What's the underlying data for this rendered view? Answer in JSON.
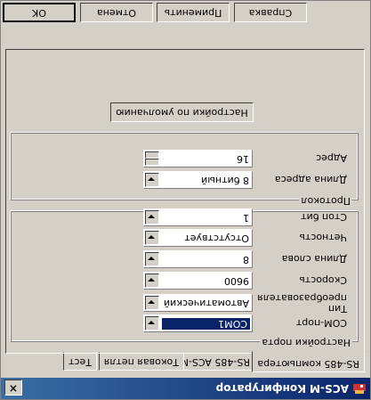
{
  "window": {
    "title": "ACS-M Конфигуратор",
    "close_glyph": "×"
  },
  "tabs": [
    {
      "label": "RS-485 компьютера"
    },
    {
      "label": "RS-485 ACS-M"
    },
    {
      "label": "Токовая петля"
    },
    {
      "label": "Тест"
    }
  ],
  "port_group": {
    "title": "Настройки порта",
    "com_label": "COM-порт",
    "com_value": "COM1",
    "conv_label_1": "Тип",
    "conv_label_2": "преобразователя",
    "conv_value": "Автоматический",
    "speed_label": "Скорость",
    "speed_value": "9600",
    "wordlen_label": "Длина слова",
    "wordlen_value": "8",
    "parity_label": "Четность",
    "parity_value": "Отсутствует",
    "stop_label": "Стоп бит",
    "stop_value": "1"
  },
  "protocol_group": {
    "title": "Протокол",
    "addrlen_label": "Длина адреса",
    "addrlen_value": "8 битный",
    "addr_label": "Адрес",
    "addr_value": "16"
  },
  "defaults_button": "Настройки по умолчанию",
  "buttons": {
    "ok": "OK",
    "cancel": "Отмена",
    "apply": "Применить",
    "help": "Справка"
  },
  "colors": {
    "face": "#d4d0c8",
    "title_dark": "#0a246a",
    "title_light": "#3a6ea5",
    "select": "#0a246a"
  }
}
